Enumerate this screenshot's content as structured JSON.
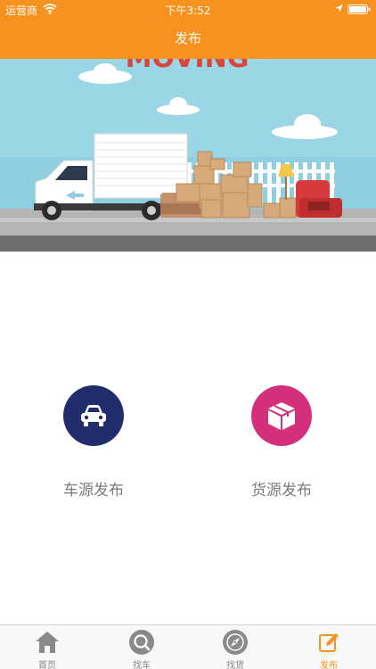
{
  "status_bar": {
    "carrier": "运营商",
    "time": "下午3:52"
  },
  "nav": {
    "title": "发布"
  },
  "banner": {
    "sign_text": "MOVING"
  },
  "actions": {
    "vehicle_publish": "车源发布",
    "cargo_publish": "货源发布"
  },
  "tabs": [
    {
      "label": "首页",
      "icon": "home-icon",
      "active": false
    },
    {
      "label": "找车",
      "icon": "search-icon",
      "active": false
    },
    {
      "label": "找货",
      "icon": "compass-icon",
      "active": false
    },
    {
      "label": "发布",
      "icon": "edit-icon",
      "active": true
    }
  ],
  "colors": {
    "accent": "#f7921e",
    "vehicle_circle": "#222d6b",
    "cargo_circle": "#d32f7b",
    "inactive_tab": "#888888"
  }
}
